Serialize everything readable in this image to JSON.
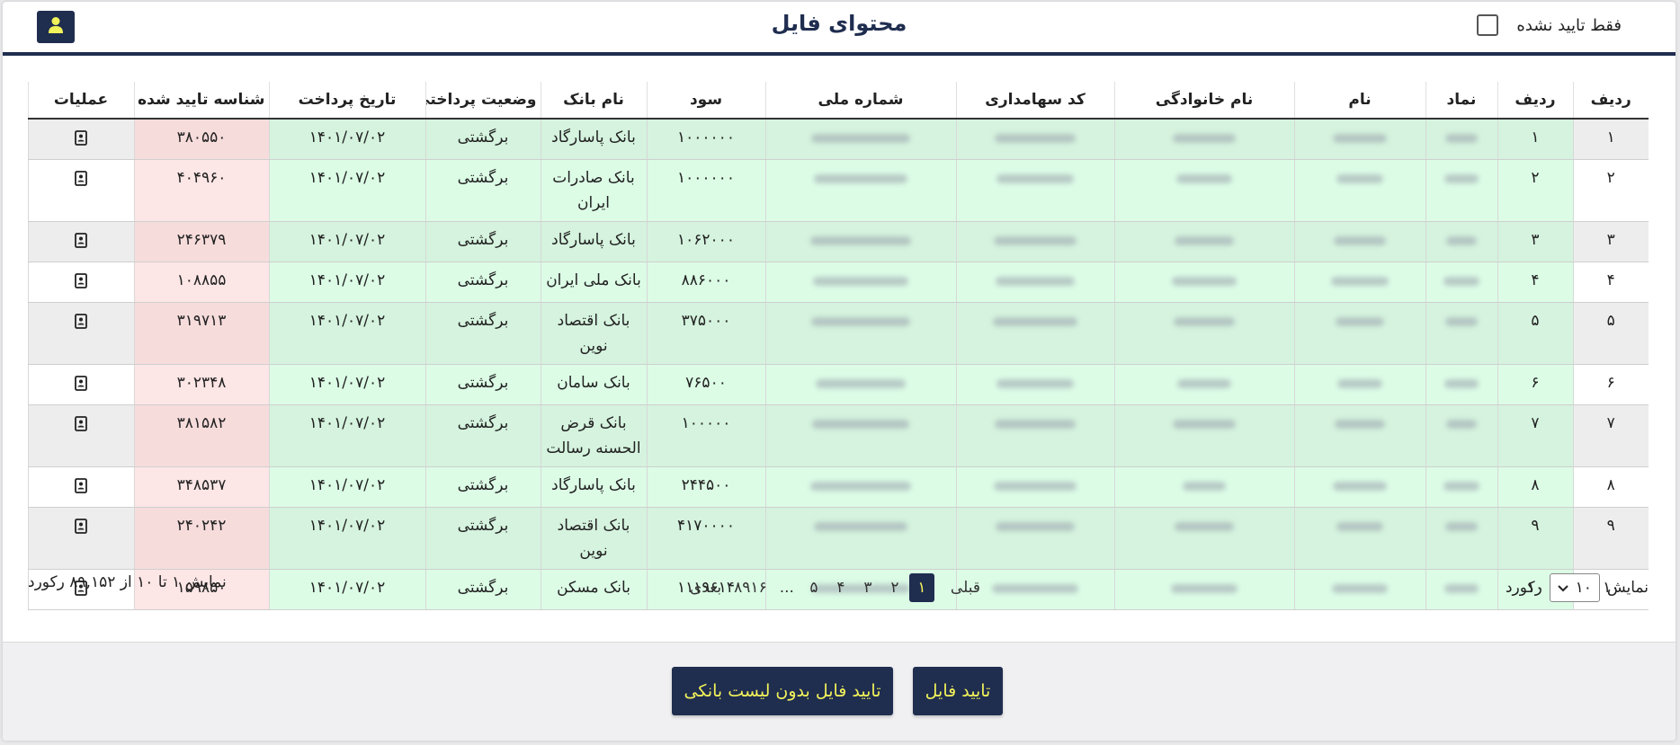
{
  "header": {
    "title": "محتوای فایل",
    "only_unconfirmed_label": "فقط تایید نشده"
  },
  "table": {
    "columns": {
      "row1": "ردیف",
      "row2": "ردیف",
      "symbol": "نماد",
      "name": "نام",
      "family": "نام خانوادگی",
      "shareholder_code": "کد سهامداری",
      "national_id": "شماره ملی",
      "profit": "سود",
      "bank": "نام بانک",
      "payment_status": "وضعیت پرداختی",
      "payment_date": "تاریخ پرداخت",
      "confirmed_id": "شناسه تایید شده",
      "operations": "عملیات"
    },
    "rows": [
      {
        "row1": "۱",
        "row2": "۱",
        "profit": "۱۰۰۰۰۰۰",
        "bank": "بانک پاسارگاد",
        "status": "برگشتی",
        "date": "۱۴۰۱/۰۷/۰۲",
        "confirmed": "۳۸۰۵۵۰",
        "lines": 1
      },
      {
        "row1": "۲",
        "row2": "۲",
        "profit": "۱۰۰۰۰۰۰",
        "bank": "بانک صادرات ایران",
        "status": "برگشتی",
        "date": "۱۴۰۱/۰۷/۰۲",
        "confirmed": "۴۰۴۹۶۰",
        "lines": 2
      },
      {
        "row1": "۳",
        "row2": "۳",
        "profit": "۱۰۶۲۰۰۰",
        "bank": "بانک پاسارگاد",
        "status": "برگشتی",
        "date": "۱۴۰۱/۰۷/۰۲",
        "confirmed": "۲۴۶۳۷۹",
        "lines": 1
      },
      {
        "row1": "۴",
        "row2": "۴",
        "profit": "۸۸۶۰۰۰",
        "bank": "بانک ملی ایران",
        "status": "برگشتی",
        "date": "۱۴۰۱/۰۷/۰۲",
        "confirmed": "۱۰۸۸۵۵",
        "lines": 1
      },
      {
        "row1": "۵",
        "row2": "۵",
        "profit": "۳۷۵۰۰۰",
        "bank": "بانک اقتصاد نوین",
        "status": "برگشتی",
        "date": "۱۴۰۱/۰۷/۰۲",
        "confirmed": "۳۱۹۷۱۳",
        "lines": 2
      },
      {
        "row1": "۶",
        "row2": "۶",
        "profit": "۷۶۵۰۰",
        "bank": "بانک سامان",
        "status": "برگشتی",
        "date": "۱۴۰۱/۰۷/۰۲",
        "confirmed": "۳۰۲۳۴۸",
        "lines": 1
      },
      {
        "row1": "۷",
        "row2": "۷",
        "profit": "۱۰۰۰۰۰",
        "bank": "بانک قرض الحسنه رسالت",
        "status": "برگشتی",
        "date": "۱۴۰۱/۰۷/۰۲",
        "confirmed": "۳۸۱۵۸۲",
        "lines": 2
      },
      {
        "row1": "۸",
        "row2": "۸",
        "profit": "۲۴۴۵۰۰",
        "bank": "بانک پاسارگاد",
        "status": "برگشتی",
        "date": "۱۴۰۱/۰۷/۰۲",
        "confirmed": "۳۴۸۵۳۷",
        "lines": 1
      },
      {
        "row1": "۹",
        "row2": "۹",
        "profit": "۴۱۷۰۰۰۰",
        "bank": "بانک اقتصاد نوین",
        "status": "برگشتی",
        "date": "۱۴۰۱/۰۷/۰۲",
        "confirmed": "۲۴۰۲۴۲",
        "lines": 2
      },
      {
        "row1": "۱۰",
        "row2": "۱۰",
        "profit": "۱۱۱۹۶۱۴",
        "bank": "بانک مسکن",
        "status": "برگشتی",
        "date": "۱۴۰۱/۰۷/۰۲",
        "confirmed": "۱۵۹۸۵۰",
        "lines": 1
      }
    ]
  },
  "page_size": {
    "prefix": "نمایش",
    "value": "۱۰",
    "suffix": "رکورد"
  },
  "pagination": {
    "prev": "قبلی",
    "pages": [
      "۱",
      "۲",
      "۳",
      "۴",
      "۵"
    ],
    "ellipsis": "...",
    "last": "۸۹۱۶",
    "next": "بعدی"
  },
  "records_info": "نمایش ۱ تا ۱۰ از ۸۹,۱۵۲ رکورد",
  "footer": {
    "confirm_file": "تایید فایل",
    "confirm_without_bank": "تایید فایل بدون لیست بانکی"
  },
  "colors": {
    "primary": "#1f2d4f",
    "accent_text": "#f2f25a",
    "green_cell": "#dcfce6",
    "pink_cell": "#fde6e6"
  }
}
